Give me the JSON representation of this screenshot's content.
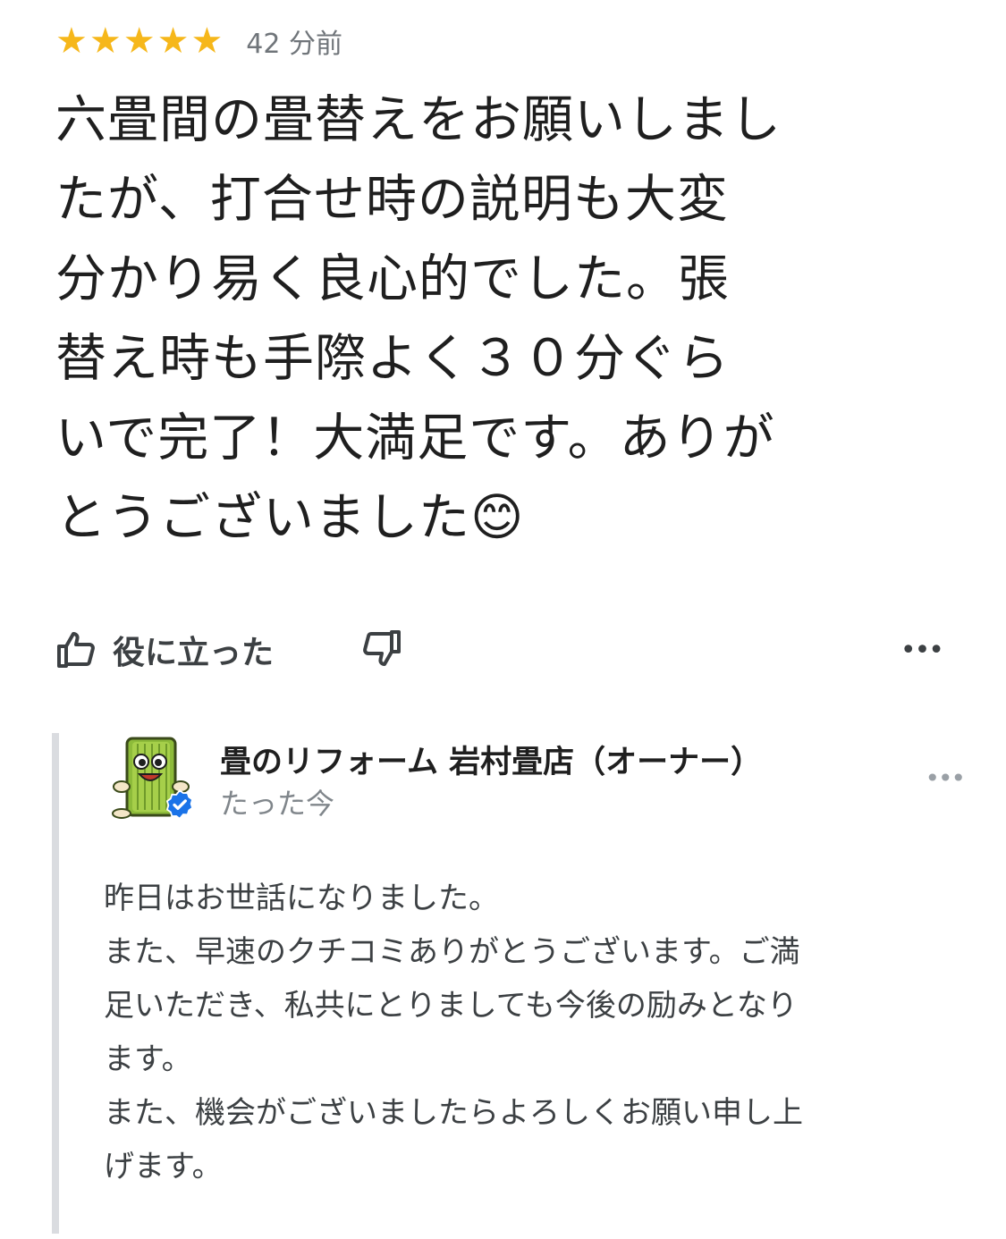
{
  "review": {
    "rating": 5,
    "rating_max": 5,
    "star_color": "#f6b71a",
    "time_ago": "42 分前",
    "text": "六畳間の畳替えをお願いしまし\nたが、打合せ時の説明も大変\n分かり易く良心的でした。張\n替え時も手際よく３０分ぐら\nいで完了！大満足です。ありが\nとうございました😊"
  },
  "actions": {
    "helpful_label": "役に立った",
    "helpful_icon": "thumbs-up-icon",
    "not_helpful_icon": "thumbs-down-icon",
    "more_icon": "more-horizontal-icon",
    "more_glyph": "•••"
  },
  "owner_reply": {
    "owner_name": "畳のリフォーム 岩村畳店（オーナー）",
    "time": "たった今",
    "avatar_icon": "tatami-mascot-avatar",
    "badge_icon": "verified-check-icon",
    "badge_color": "#1a73e8",
    "more_glyph": "•••",
    "text": "昨日はお世話になりました。\nまた、早速のクチコミありがとうございます。ご満\n足いただき、私共にとりましても今後の励みとなり\nます。\nまた、機会がございましたらよろしくお願い申し上\nげます。"
  }
}
